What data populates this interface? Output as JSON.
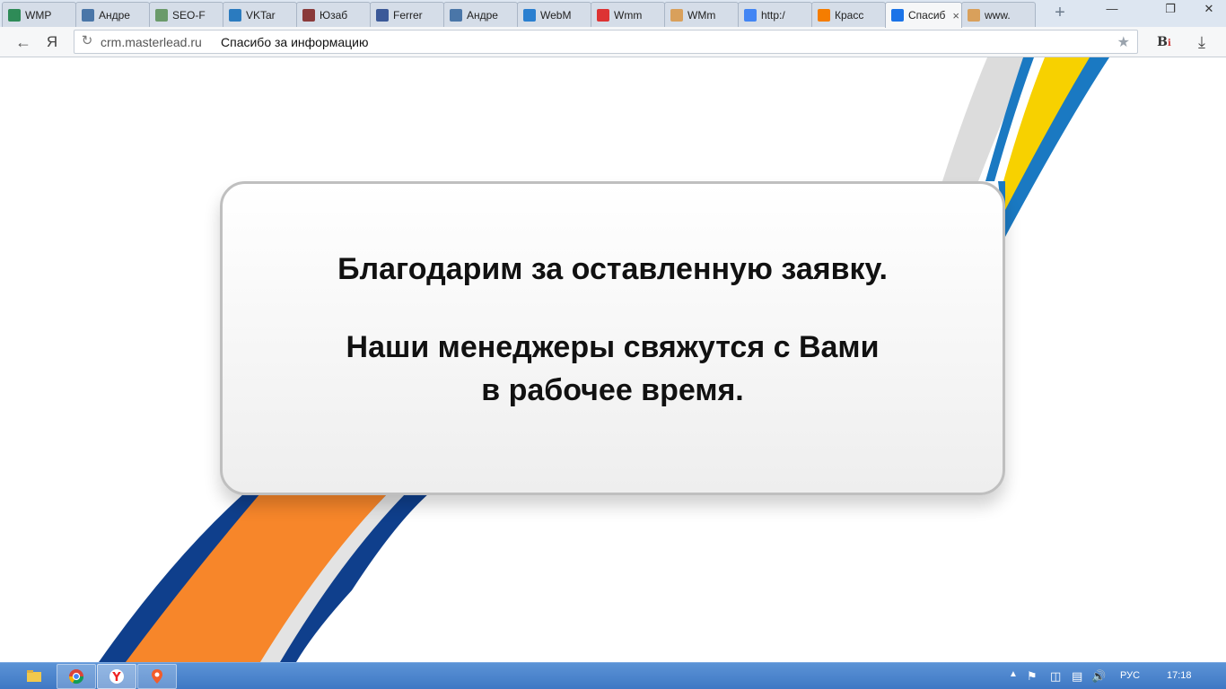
{
  "tabs": [
    {
      "title": "WMP",
      "icon": "wmp-icon",
      "color": "#2e8b57"
    },
    {
      "title": "Андре",
      "icon": "vk-icon",
      "color": "#4a76a8"
    },
    {
      "title": "SEO-F",
      "icon": "seo-icon",
      "color": "#6a9a6a"
    },
    {
      "title": "VKTar",
      "icon": "vktarget-icon",
      "color": "#2b7bbf"
    },
    {
      "title": "Юзаб",
      "icon": "t-icon",
      "color": "#8a3a3a"
    },
    {
      "title": "Ferrer",
      "icon": "facebook-icon",
      "color": "#3b5998"
    },
    {
      "title": "Андре",
      "icon": "vk-icon",
      "color": "#4a76a8"
    },
    {
      "title": "WebM",
      "icon": "globe-icon",
      "color": "#2a7fd0"
    },
    {
      "title": "Wmm",
      "icon": "yandex-icon",
      "color": "#d33"
    },
    {
      "title": "WMm",
      "icon": "cookie-icon",
      "color": "#d9a05b"
    },
    {
      "title": "http:/",
      "icon": "google-icon",
      "color": "#4285f4"
    },
    {
      "title": "Красс",
      "icon": "blogger-icon",
      "color": "#f57d00"
    },
    {
      "title": "Спасиб",
      "icon": "page-icon",
      "color": "#1a73e8",
      "active": true
    },
    {
      "title": "www.",
      "icon": "cookie-icon",
      "color": "#d9a05b"
    }
  ],
  "toolbar": {
    "back": "←",
    "yandex_logo": "Я",
    "url_domain": "crm.masterlead.ru",
    "url_title": "Спасибо за информацию"
  },
  "page": {
    "thanks_line": "Благодарим за оставленную заявку.",
    "contact_line_1": "Наши менеджеры свяжутся с Вами",
    "contact_line_2": "в рабочее время."
  },
  "taskbar": {
    "language": "РУС",
    "clock": "17:18"
  },
  "colors": {
    "ribbon_blue": "#1a79c2",
    "ribbon_yellow": "#f7d100",
    "ribbon_orange": "#f7862a",
    "ribbon_navy": "#0f3f8c",
    "ribbon_gray": "#dcdcdc"
  }
}
